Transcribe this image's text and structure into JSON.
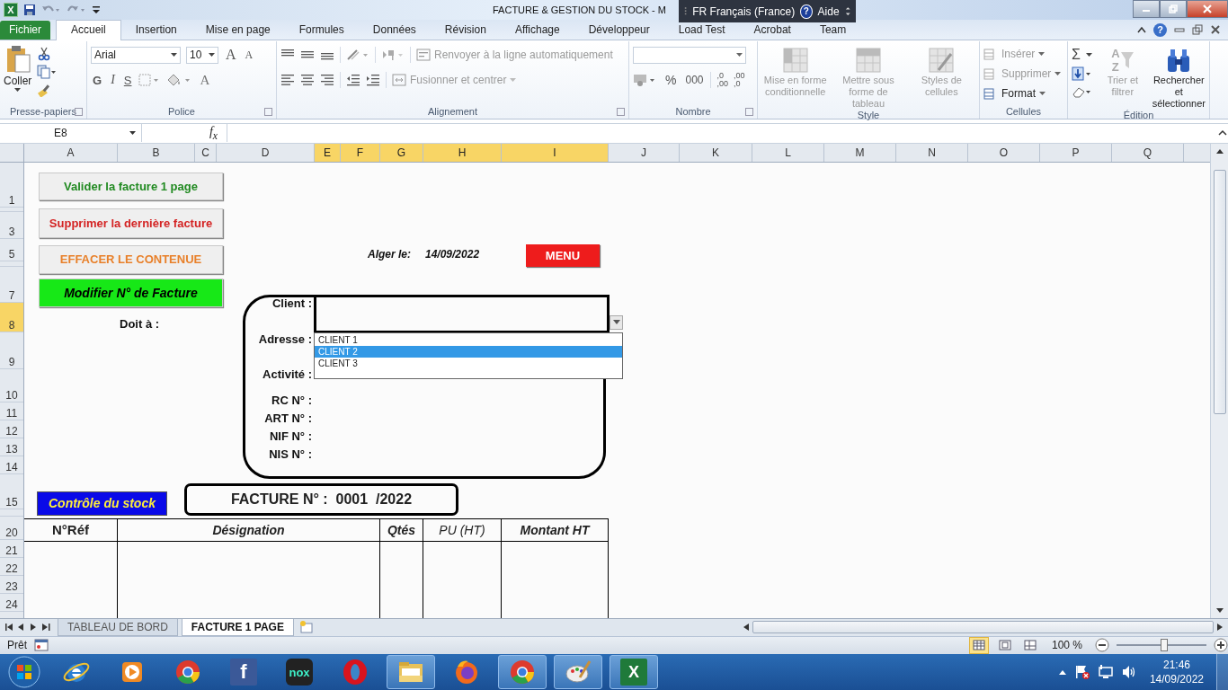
{
  "title_bar": {
    "app_glyph": "X",
    "title": "FACTURE & GESTION DU STOCK - M",
    "language_bar": {
      "language": "FR Français (France)",
      "help_glyph": "?",
      "help": "Aide"
    }
  },
  "ribbon_tabs": [
    {
      "label": "Fichier",
      "kind": "file",
      "selected": false
    },
    {
      "label": "Accueil",
      "kind": "tab",
      "selected": true
    },
    {
      "label": "Insertion",
      "kind": "tab",
      "selected": false
    },
    {
      "label": "Mise en page",
      "kind": "tab",
      "selected": false
    },
    {
      "label": "Formules",
      "kind": "tab",
      "selected": false
    },
    {
      "label": "Données",
      "kind": "tab",
      "selected": false
    },
    {
      "label": "Révision",
      "kind": "tab",
      "selected": false
    },
    {
      "label": "Affichage",
      "kind": "tab",
      "selected": false
    },
    {
      "label": "Développeur",
      "kind": "tab",
      "selected": false
    },
    {
      "label": "Load Test",
      "kind": "tab",
      "selected": false
    },
    {
      "label": "Acrobat",
      "kind": "tab",
      "selected": false
    },
    {
      "label": "Team",
      "kind": "tab",
      "selected": false
    }
  ],
  "ribbon_help_glyph": "?",
  "ribbon": {
    "clipboard": {
      "paste": "Coller",
      "label": "Presse-papiers"
    },
    "font": {
      "name": "Arial",
      "size": "10",
      "grow": "A",
      "shrink": "A",
      "bold": "G",
      "italic": "I",
      "underline": "S",
      "color_glyph": "A",
      "label": "Police"
    },
    "alignment": {
      "wrap": {
        "label": "Renvoyer à la ligne automatiquement",
        "disabled": true
      },
      "merge": {
        "label": "Fusionner et centrer",
        "disabled": true
      },
      "label": "Alignement"
    },
    "number": {
      "percent": "%",
      "thousands": "000",
      "inc_decimal": [
        ",0",
        ",00"
      ],
      "dec_decimal": [
        ",00",
        ",0"
      ],
      "label": "Nombre"
    },
    "style": {
      "items": [
        {
          "label": "Mise en forme conditionnelle",
          "disabled": true
        },
        {
          "label": "Mettre sous forme de tableau",
          "disabled": true
        },
        {
          "label": "Styles de cellules",
          "disabled": true
        }
      ],
      "label": "Style"
    },
    "cells": {
      "items": [
        {
          "label": "Insérer",
          "disabled": true
        },
        {
          "label": "Supprimer",
          "disabled": true
        },
        {
          "label": "Format",
          "disabled": false
        }
      ],
      "label": "Cellules"
    },
    "editing": {
      "sum": "Σ",
      "sort_letters": [
        "A",
        "Z"
      ],
      "sort": {
        "label": "Trier et filtrer",
        "disabled": true
      },
      "find": {
        "label": "Rechercher et sélectionner",
        "disabled": false
      },
      "label": "Édition"
    }
  },
  "formula_bar": {
    "name_box": "E8",
    "fx": "f$_{x}$"
  },
  "sheet": {
    "columns": [
      {
        "label": "A",
        "selected": false
      },
      {
        "label": "B",
        "selected": false
      },
      {
        "label": "C",
        "selected": false
      },
      {
        "label": "D",
        "selected": false
      },
      {
        "label": "E",
        "selected": true
      },
      {
        "label": "F",
        "selected": true
      },
      {
        "label": "G",
        "selected": true
      },
      {
        "label": "H",
        "selected": true
      },
      {
        "label": "I",
        "selected": true
      },
      {
        "label": "J",
        "selected": false
      },
      {
        "label": "K",
        "selected": false
      },
      {
        "label": "L",
        "selected": false
      },
      {
        "label": "M",
        "selected": false
      },
      {
        "label": "N",
        "selected": false
      },
      {
        "label": "O",
        "selected": false
      },
      {
        "label": "P",
        "selected": false
      },
      {
        "label": "Q",
        "selected": false
      }
    ],
    "rows": [
      {
        "label": "1",
        "selected": false
      },
      {
        "label": "3",
        "selected": false
      },
      {
        "label": "5",
        "selected": false
      },
      {
        "label": "7",
        "selected": false
      },
      {
        "label": "8",
        "selected": true
      },
      {
        "label": "9",
        "selected": false
      },
      {
        "label": "10",
        "selected": false
      },
      {
        "label": "11",
        "selected": false
      },
      {
        "label": "12",
        "selected": false
      },
      {
        "label": "13",
        "selected": false
      },
      {
        "label": "14",
        "selected": false
      },
      {
        "label": "15",
        "selected": false
      },
      {
        "label": "20",
        "selected": false
      },
      {
        "label": "21",
        "selected": false
      },
      {
        "label": "22",
        "selected": false
      },
      {
        "label": "23",
        "selected": false
      },
      {
        "label": "24",
        "selected": false
      }
    ],
    "buttons": [
      {
        "label": "Valider la facture 1 page",
        "kind": "grey",
        "color": "#218a21"
      },
      {
        "label": "Supprimer la dernière facture",
        "kind": "grey",
        "color": "#d42424"
      },
      {
        "label": "EFFACER  LE CONTENUE",
        "kind": "grey",
        "color": "#e8802a"
      },
      {
        "label": "Modifier N° de Facture",
        "kind": "green"
      }
    ],
    "debtor_label": "Doit à :",
    "date_label": "Alger le:",
    "date": "14/09/2022",
    "menu_button": "MENU",
    "client_fields": [
      "Client :",
      "Adresse :",
      "Activité :",
      "RC N° :",
      "ART N° :",
      "NIF N° :",
      "NIS N° :"
    ],
    "client_dropdown": [
      {
        "label": "CLIENT 1",
        "selected": false
      },
      {
        "label": "CLIENT 2",
        "selected": true
      },
      {
        "label": "CLIENT 3",
        "selected": false
      }
    ],
    "stock_button": "Contrôle du stock",
    "invoice_number": "FACTURE N° :  0001  /2022",
    "table_columns": [
      "N°Réf",
      "Désignation",
      "Qtés",
      "PU (HT)",
      "Montant HT"
    ]
  },
  "sheet_tabs": [
    {
      "label": "TABLEAU DE BORD",
      "selected": false
    },
    {
      "label": "FACTURE 1 PAGE",
      "selected": true
    }
  ],
  "status_bar": {
    "status": "Prêt",
    "zoom": "100 %",
    "zoom_slider": {
      "level": 0.53
    }
  },
  "taskbar": {
    "apps": [
      {
        "kind": "ie",
        "running": false
      },
      {
        "kind": "media",
        "running": false
      },
      {
        "kind": "chrome",
        "running": false
      },
      {
        "kind": "facebook",
        "glyph": "f",
        "running": false
      },
      {
        "kind": "nox",
        "glyph": "nox",
        "running": false
      },
      {
        "kind": "opera",
        "running": false
      },
      {
        "kind": "explorer",
        "running": true
      },
      {
        "kind": "firefox",
        "running": false
      },
      {
        "kind": "chrome",
        "running": true
      },
      {
        "kind": "paint",
        "running": true
      },
      {
        "kind": "excel",
        "glyph": "X",
        "running": true
      }
    ],
    "time": "21:46",
    "date": "14/09/2022"
  }
}
